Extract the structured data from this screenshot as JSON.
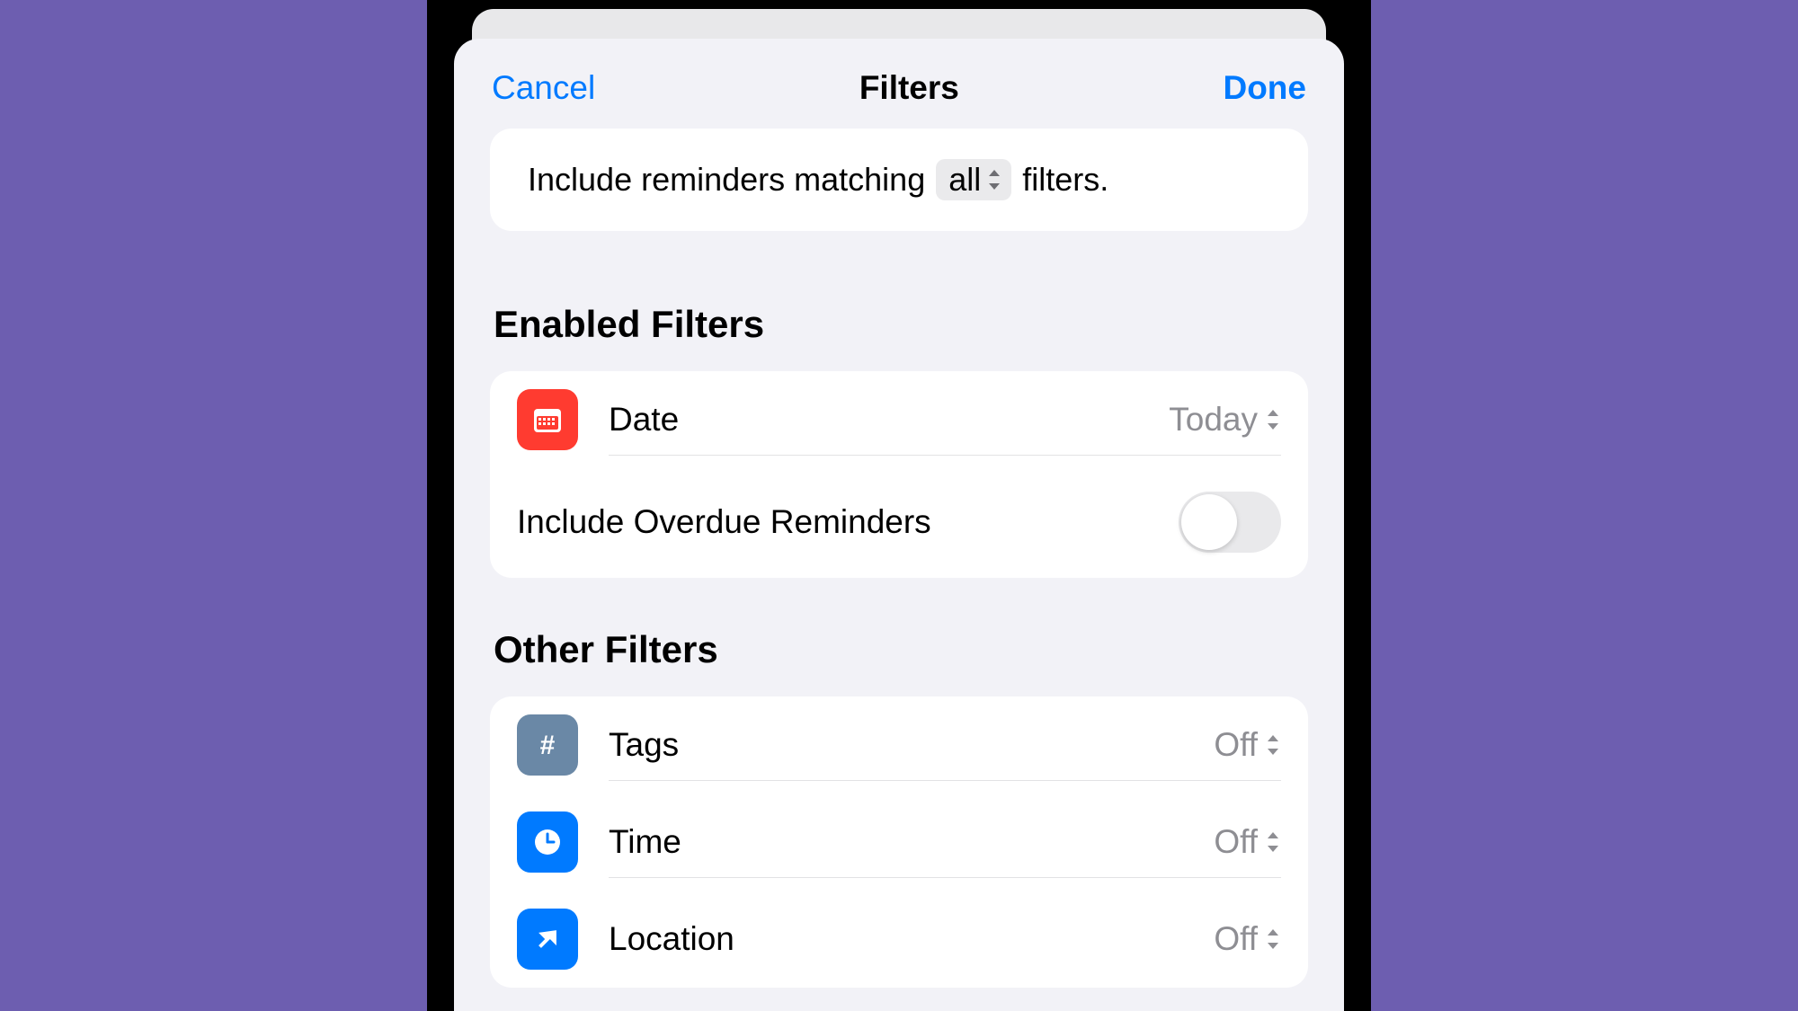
{
  "nav": {
    "cancel": "Cancel",
    "title": "Filters",
    "done": "Done"
  },
  "summary": {
    "prefix": "Include reminders matching",
    "match_mode": "all",
    "mode_icon": "up-down-icon",
    "suffix": "filters."
  },
  "enabled_section": {
    "title": "Enabled Filters",
    "filters": [
      {
        "icon": "calendar-icon",
        "color": "red",
        "label": "Date",
        "value": "Today"
      }
    ],
    "overdue": {
      "label": "Include Overdue Reminders",
      "enabled": false
    }
  },
  "other_section": {
    "title": "Other Filters",
    "filters": [
      {
        "icon": "hash-icon",
        "color": "blue-gray",
        "label": "Tags",
        "value": "Off"
      },
      {
        "icon": "clock-icon",
        "color": "blue",
        "label": "Time",
        "value": "Off"
      },
      {
        "icon": "location-icon",
        "color": "blue",
        "label": "Location",
        "value": "Off"
      }
    ]
  }
}
